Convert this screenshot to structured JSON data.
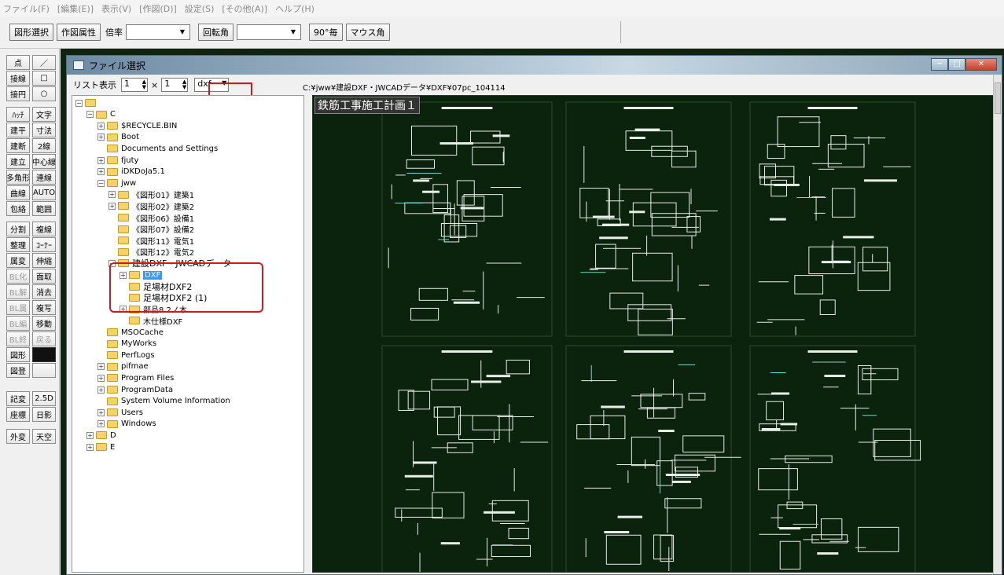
{
  "menu": [
    "ファイル(F)",
    "[編集(E)]",
    "表示(V)",
    "[作図(D)]",
    "設定(S)",
    "[その他(A)]",
    "ヘルプ(H)"
  ],
  "toolbar": {
    "select_label": "図形選択",
    "attr_label": "作図属性",
    "scale_label": "倍率",
    "rotate_label": "回転角",
    "deg90_label": "90°毎",
    "mouse_angle_label": "マウス角"
  },
  "palette": {
    "buttons": [
      "点",
      "／",
      "接線",
      "□",
      "接円",
      "○",
      "ﾊｯﾁ",
      "文字",
      "建平",
      "寸法",
      "建断",
      "2線",
      "建立",
      "中心線",
      "多角形",
      "連線",
      "曲線",
      "AUTO",
      "包絡",
      "範囲",
      "分割",
      "複線",
      "整理",
      "ｺｰﾅｰ",
      "属変",
      "伸縮",
      "BL化",
      "面取",
      "BL解",
      "消去",
      "BL属",
      "複写",
      "BL編",
      "移動",
      "BL終",
      "戻る",
      "図形",
      "",
      "図登",
      "",
      "記変",
      "2.5D",
      "座標",
      "日影",
      "外変",
      "天空"
    ]
  },
  "dialog": {
    "title": "ファイル選択",
    "list_label": "リスト表示",
    "spin1": "1",
    "times": "×",
    "spin2": "1",
    "ext": "dxf",
    "path": "C:¥jww¥建設DXF・JWCADデータ¥DXF¥07pc_104114"
  },
  "tree": [
    {
      "label": "",
      "indent": 0,
      "exp": "-"
    },
    {
      "label": "C",
      "indent": 1,
      "exp": "-"
    },
    {
      "label": "$RECYCLE.BIN",
      "indent": 2,
      "exp": "+"
    },
    {
      "label": "Boot",
      "indent": 2,
      "exp": "+"
    },
    {
      "label": "Documents and Settings",
      "indent": 2,
      "exp": ""
    },
    {
      "label": "fjuty",
      "indent": 2,
      "exp": "+"
    },
    {
      "label": "iDKDoJa5.1",
      "indent": 2,
      "exp": "+"
    },
    {
      "label": "jww",
      "indent": 2,
      "exp": "-"
    },
    {
      "label": "《図形01》建築1",
      "indent": 3,
      "exp": "+"
    },
    {
      "label": "《図形02》建築2",
      "indent": 3,
      "exp": "+"
    },
    {
      "label": "《図形06》設備1",
      "indent": 3,
      "exp": ""
    },
    {
      "label": "《図形07》設備2",
      "indent": 3,
      "exp": ""
    },
    {
      "label": "《図形11》電気1",
      "indent": 3,
      "exp": ""
    },
    {
      "label": "《図形12》電気2",
      "indent": 3,
      "exp": ""
    },
    {
      "label": "建設DXF・JWCADデータ",
      "indent": 3,
      "exp": "-",
      "big": true
    },
    {
      "label": "DXF",
      "indent": 4,
      "exp": "+",
      "selected": true
    },
    {
      "label": "足場材DXF2",
      "indent": 4,
      "exp": "",
      "big": true
    },
    {
      "label": "足場材DXF2 (1)",
      "indent": 4,
      "exp": "",
      "big": true
    },
    {
      "label": "部品8.2ノ木",
      "indent": 4,
      "exp": "+"
    },
    {
      "label": "木仕様DXF",
      "indent": 4,
      "exp": ""
    },
    {
      "label": "MSOCache",
      "indent": 2,
      "exp": ""
    },
    {
      "label": "MyWorks",
      "indent": 2,
      "exp": ""
    },
    {
      "label": "PerfLogs",
      "indent": 2,
      "exp": ""
    },
    {
      "label": "pifmae",
      "indent": 2,
      "exp": "+"
    },
    {
      "label": "Program Files",
      "indent": 2,
      "exp": "+"
    },
    {
      "label": "ProgramData",
      "indent": 2,
      "exp": "+"
    },
    {
      "label": "System Volume Information",
      "indent": 2,
      "exp": ""
    },
    {
      "label": "Users",
      "indent": 2,
      "exp": "+"
    },
    {
      "label": "Windows",
      "indent": 2,
      "exp": "+"
    },
    {
      "label": "D",
      "indent": 1,
      "exp": "+"
    },
    {
      "label": "E",
      "indent": 1,
      "exp": "+"
    }
  ],
  "preview": {
    "sheet_title": "鉄筋工事施工計画１"
  },
  "colors": {
    "canvas": "#0e2410",
    "line": "#e8efe8",
    "accent_line": "#7fd6c8",
    "highlight": "#d01a1a",
    "selected": "#3399ff"
  }
}
